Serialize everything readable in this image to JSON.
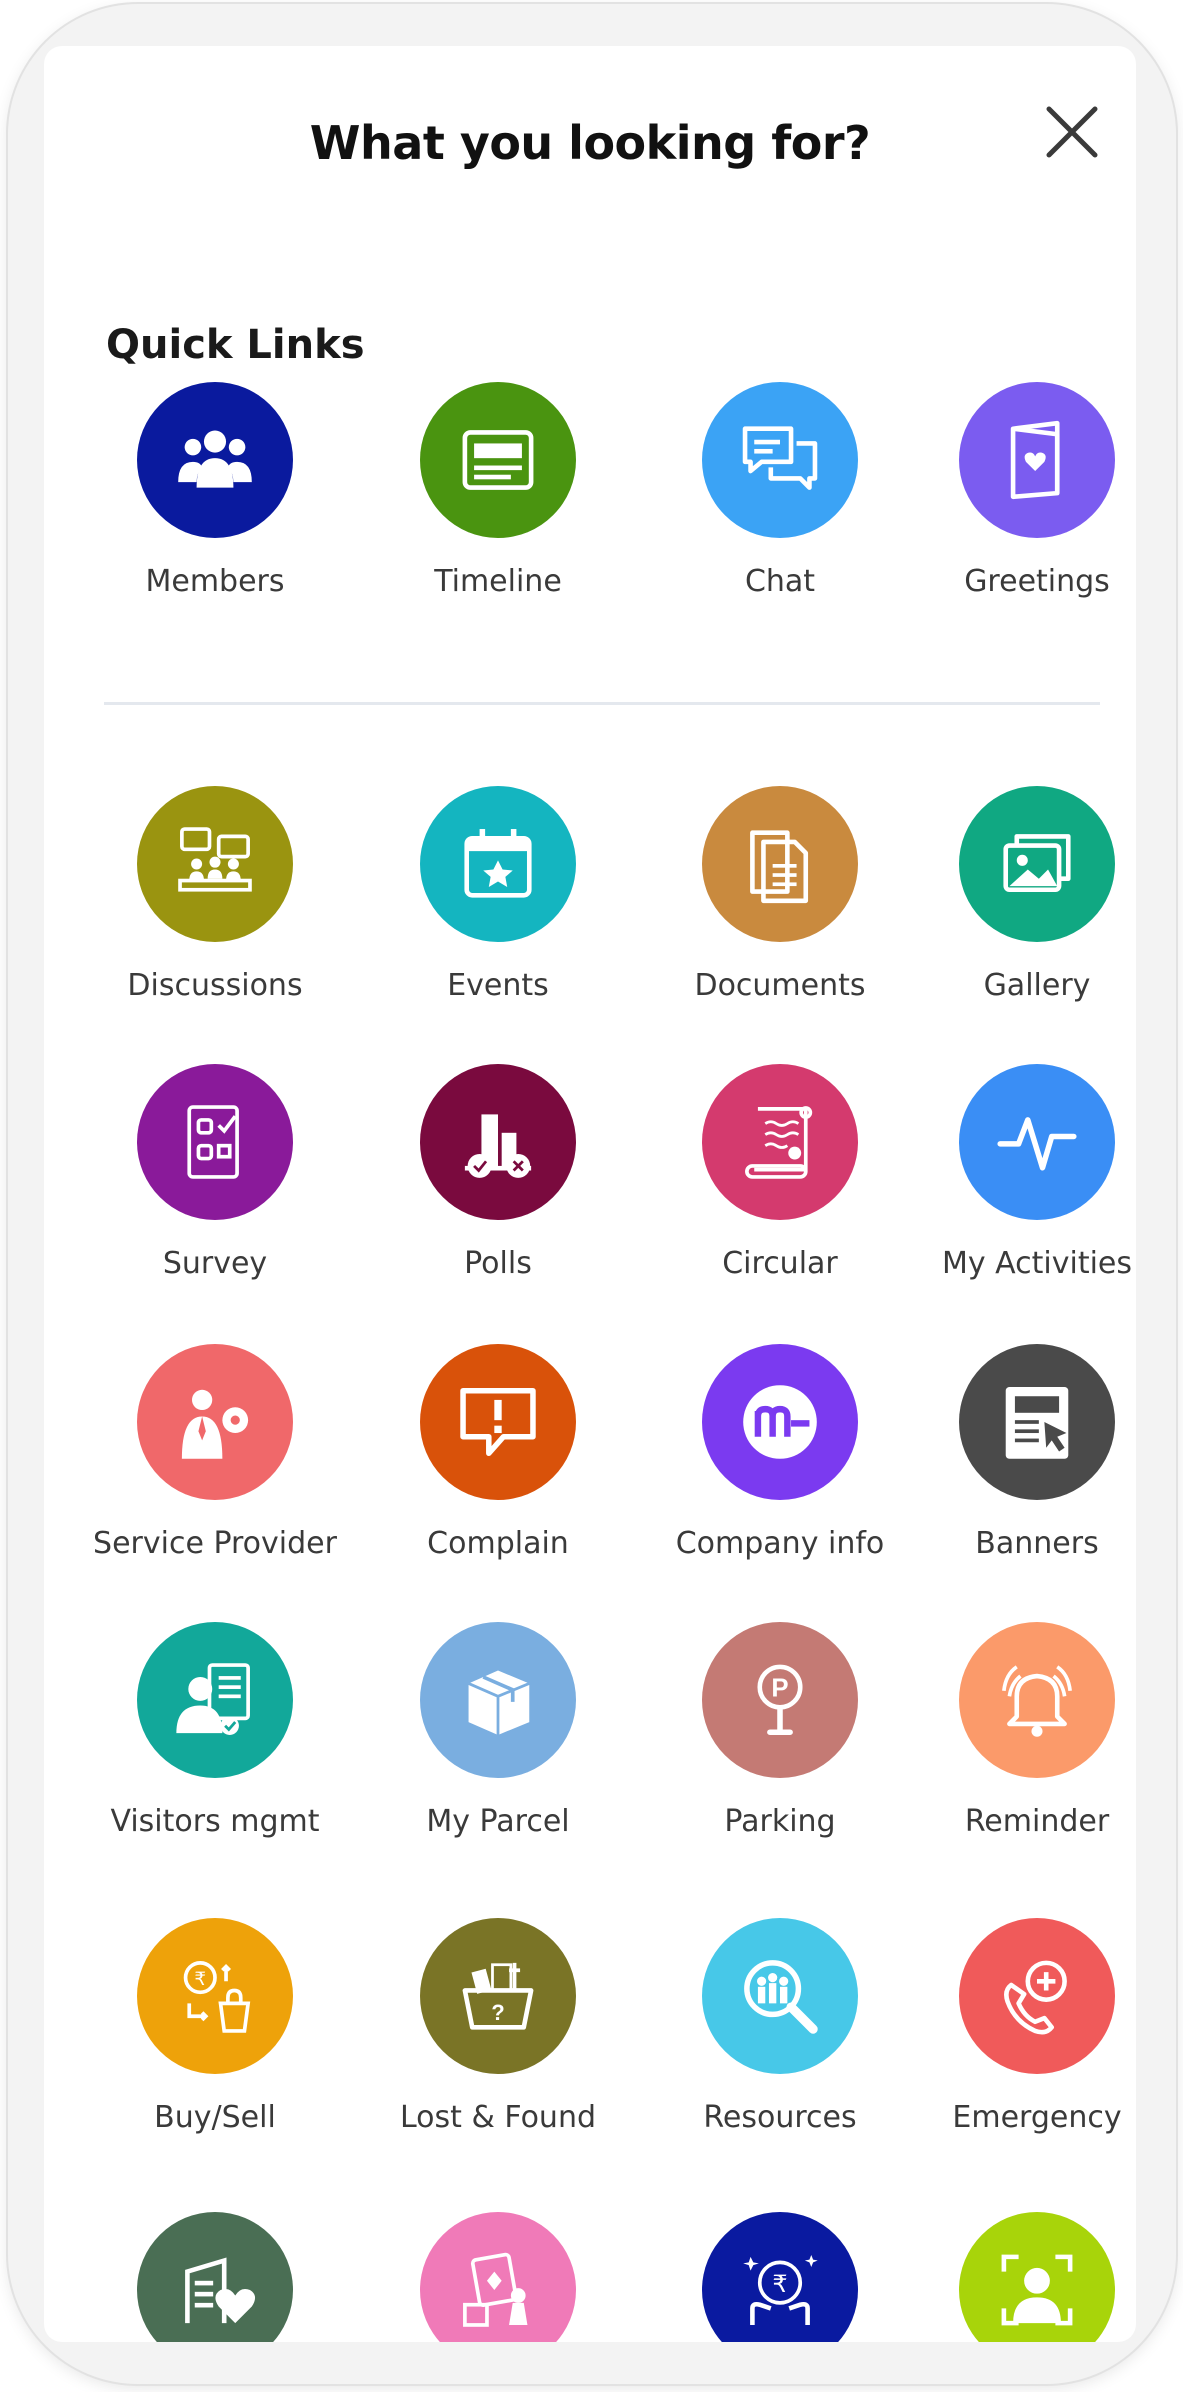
{
  "header": {
    "title": "What you looking for?"
  },
  "quick_links": {
    "title": "Quick Links",
    "items": [
      {
        "label": "Members",
        "icon": "members-icon",
        "color": "#0a1a9e"
      },
      {
        "label": "Timeline",
        "icon": "timeline-icon",
        "color": "#4a9410"
      },
      {
        "label": "Chat",
        "icon": "chat-icon",
        "color": "#3ba3f5"
      },
      {
        "label": "Greetings",
        "icon": "greetings-icon",
        "color": "#7b5cf0"
      }
    ]
  },
  "modules": [
    {
      "label": "Discussions",
      "icon": "discussions-icon",
      "color": "#9a9410"
    },
    {
      "label": "Events",
      "icon": "events-icon",
      "color": "#14b5c0"
    },
    {
      "label": "Documents",
      "icon": "documents-icon",
      "color": "#c98a3e"
    },
    {
      "label": "Gallery",
      "icon": "gallery-icon",
      "color": "#10a882"
    },
    {
      "label": "Survey",
      "icon": "survey-icon",
      "color": "#8a1a9a"
    },
    {
      "label": "Polls",
      "icon": "polls-icon",
      "color": "#7a0a3e"
    },
    {
      "label": "Circular",
      "icon": "circular-icon",
      "color": "#d43a6e"
    },
    {
      "label": "My Activities",
      "icon": "activity-icon",
      "color": "#3a8ef5"
    },
    {
      "label": "Service Provider",
      "icon": "service-provider-icon",
      "color": "#f0686a"
    },
    {
      "label": "Complain",
      "icon": "complain-icon",
      "color": "#d9520a"
    },
    {
      "label": "Company info",
      "icon": "company-info-icon",
      "color": "#7b3af0"
    },
    {
      "label": "Banners",
      "icon": "banners-icon",
      "color": "#4a4a4a"
    },
    {
      "label": "Visitors mgmt",
      "icon": "visitors-icon",
      "color": "#12a89a"
    },
    {
      "label": "My Parcel",
      "icon": "parcel-icon",
      "color": "#7aaee0"
    },
    {
      "label": "Parking",
      "icon": "parking-icon",
      "color": "#c47a74"
    },
    {
      "label": "Reminder",
      "icon": "reminder-icon",
      "color": "#fb9a6a"
    },
    {
      "label": "Buy/Sell",
      "icon": "buy-sell-icon",
      "color": "#eea20a"
    },
    {
      "label": "Lost & Found",
      "icon": "lost-found-icon",
      "color": "#7a7426"
    },
    {
      "label": "Resources",
      "icon": "resources-icon",
      "color": "#47c8e8"
    },
    {
      "label": "Emergency",
      "icon": "emergency-icon",
      "color": "#f05a5a"
    },
    {
      "label": "",
      "icon": "favorites-icon",
      "color": "#4a6e54"
    },
    {
      "label": "",
      "icon": "games-icon",
      "color": "#f07ab8"
    },
    {
      "label": "",
      "icon": "rupee-award-icon",
      "color": "#0a1aa0"
    },
    {
      "label": "",
      "icon": "face-scan-icon",
      "color": "#a8d40a"
    }
  ]
}
